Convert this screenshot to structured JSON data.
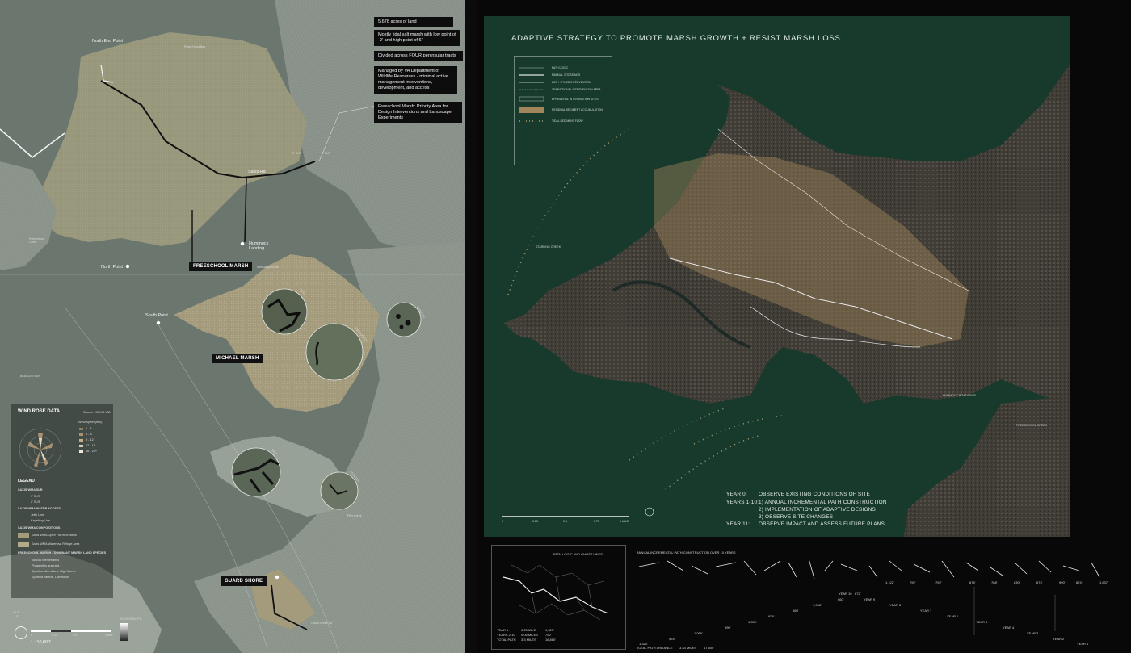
{
  "left": {
    "callouts": [
      "5,678 acres of land",
      "Mostly tidal salt marsh with low point of -2' and high point of 6'",
      "Divided across FOUR peninsular tracts",
      "Managed by VA Department of Wildlife Resources - minimal active management interventions, development, and access",
      "Freeschool Marsh: Priority Area for Design Interventions and Landscape Experiments"
    ],
    "tags": {
      "freeschool": "FREESCHOOL MARSH",
      "michael": "MICHAEL MARSH",
      "guard": "GUARD SHORE"
    },
    "points": {
      "north_end": "North End Point",
      "north_point": "North Point",
      "south_point": "South Point",
      "hummock": "Hummock Landing",
      "saxis_rd": "Saxis Rd",
      "freeschool_creek": "Freeschool Creek",
      "pocomoke": "Pocomoke Sound",
      "beasley": "BEASLEY BAY",
      "messongo": "Messongo Creek",
      "pitts_creek": "Pitts Creek",
      "guard_shore_rd": "Guard Shore Rd",
      "robin_hood": "Robin Hood Bay",
      "slr2": "2' SLR",
      "slr3": "3' SLR"
    },
    "circles": [
      "FOOL",
      "SAXIS CR.",
      "MESSONGO",
      "SALT",
      "STURGES"
    ],
    "legend": {
      "title": "WIND ROSE DATA",
      "source": "Source : SAXIS WD",
      "wind_title": "Wind Speed(m/s)",
      "wind": [
        "0 - 4",
        "4 - 8",
        "8 - 12",
        "12 - 16",
        "16 - 20+"
      ],
      "legend_title": "LEGEND",
      "slr_title": "SAXIS WMA SLR",
      "slr": [
        "1' SLR",
        "2' SLR"
      ],
      "water_title": "SAXIS WMA WATER ACCESS",
      "water": [
        "Jetty Line",
        "Kayaking Line"
      ],
      "comp_title": "SAXIS WMA COMPOSITIONS",
      "comp": [
        "Saxis WMA Open For Recreation",
        "Saxis WMA Waterfowl Refuge Area"
      ],
      "species_title": "FREESCHOOL MARSH - DOMINANT MARSH LAND SPECIES",
      "species": [
        "Juncus roemerianus",
        "Phragmites australis",
        "Spartina alterniflora, High Marsh",
        "Spartina patens, Low Marsh"
      ]
    },
    "scale": {
      "label": "1 : 10,000'",
      "ticks": [
        "0",
        "0.25",
        "0.5",
        "1 Mile"
      ],
      "elev_title": "ELEVATION (FT)",
      "elev_hi": "+1.5'",
      "elev_lo": "-4.5'"
    }
  },
  "right": {
    "title": "ADAPTIVE STRATEGY TO PROMOTE MARSH GROWTH + RESIST MARSH LOSS",
    "legend": [
      "PATH LOGIC",
      "MANUAL CROSSINGS",
      "PATH + FIXED INTERVENTION",
      "TRANSITIONAL INTERVENTION AREA",
      "EPHEMERAL INTERVENTION SITES",
      "RESIDUAL SEDIMENT ACCUMULATION",
      "TIDAL SEDIMENT FLOW"
    ],
    "labels": {
      "starling": "STARLING CREEK",
      "hummock": "HUMMOCK BOAT RAMP",
      "freeschool": "FREESCHOOL CREEK"
    },
    "years": [
      {
        "k": "YEAR 0:",
        "v": "OBSERVE EXISTING CONDITIONS OF SITE"
      },
      {
        "k": "YEARS 1-10:",
        "v": "1) ANNUAL INCREMENTAL PATH CONSTRUCTION"
      },
      {
        "k": "",
        "v": "2) IMPLEMENTATION OF ADAPTIVE DESIGNS"
      },
      {
        "k": "",
        "v": "3) OBSERVE SITE CHANGES"
      },
      {
        "k": "YEAR 11:",
        "v": "OBSERVE IMPACT AND ASSESS FUTURE PLANS"
      }
    ],
    "scale": [
      "0",
      "0.25",
      "0.5",
      "0.75",
      "1 MILE"
    ],
    "path_logic_title": "PATH LOGIC AND GHOST LINES",
    "annual_title": "ANNUAL INCREMENTAL PATH CONSTRUCTION OVER 10 YEARS",
    "stats": {
      "year1": "YEAR 1",
      "years": "YEARS 2-10",
      "total": "TOTAL PATH",
      "v1": "0.25 MILE",
      "v2": "0.05 MILES",
      "v3": "3.3 MILES",
      "f1": "1,320'",
      "f2": "792'",
      "f3": "16,860'"
    },
    "total_distance": {
      "label": "TOTAL PATH DISTANCE",
      "miles": "3.33 MILES",
      "feet": "17,600'"
    },
    "year_labels": [
      "YEAR 1",
      "YEAR 2",
      "YEAR 3",
      "YEAR 4",
      "YEAR 5",
      "YEAR 6",
      "YEAR 7",
      "YEAR 8",
      "YEAR 9",
      "YEAR 10"
    ],
    "lengths": [
      "1,320'",
      "1,056'",
      "924'",
      "990'",
      "1,050'",
      "924'",
      "660'",
      "1,008'",
      "660'",
      "672'",
      "1,122'",
      "792'",
      "792'",
      "674'",
      "768'",
      "830'",
      "674'",
      "990'",
      "674'",
      "1,637'"
    ]
  }
}
